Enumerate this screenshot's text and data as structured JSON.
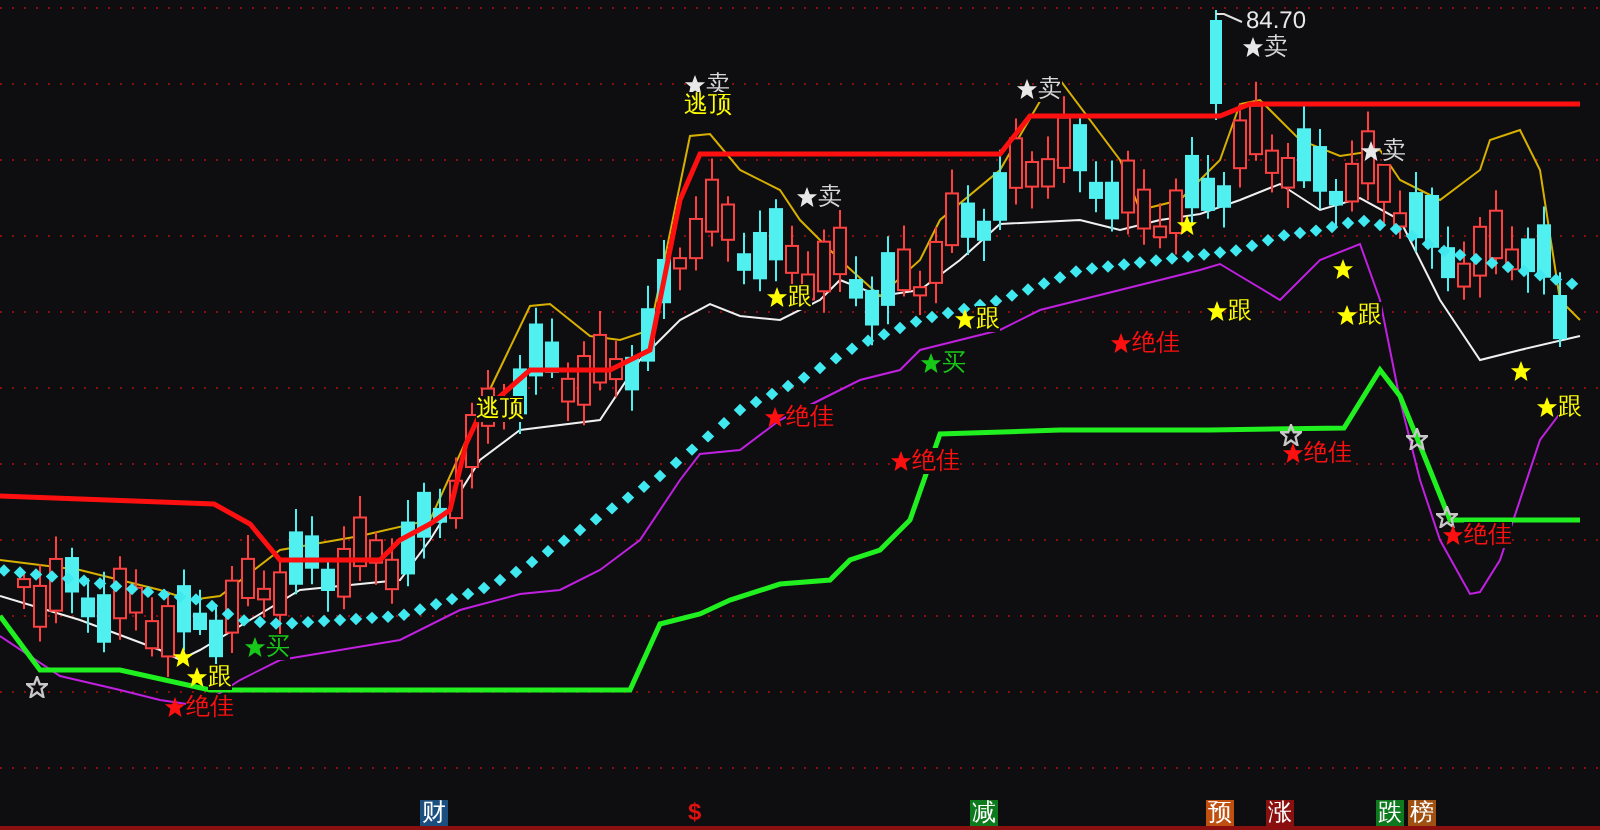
{
  "price_label": "84.70",
  "signals": [
    {
      "kind": "sell",
      "text": "卖"
    },
    {
      "kind": "sell",
      "text": "卖"
    },
    {
      "kind": "escape",
      "text": "逃顶"
    },
    {
      "kind": "sell",
      "text": "卖"
    },
    {
      "kind": "sell",
      "text": "卖"
    },
    {
      "kind": "sell",
      "text": "卖"
    },
    {
      "kind": "follow",
      "text": "跟"
    },
    {
      "kind": "follow",
      "text": "跟"
    },
    {
      "kind": "follow",
      "text": "跟"
    },
    {
      "kind": "follow",
      "text": "跟"
    },
    {
      "kind": "best",
      "text": "绝佳"
    },
    {
      "kind": "buy",
      "text": "买"
    },
    {
      "kind": "escape",
      "text": "逃顶"
    },
    {
      "kind": "follow",
      "text": "跟"
    },
    {
      "kind": "best",
      "text": "绝佳"
    },
    {
      "kind": "best",
      "text": "绝佳"
    },
    {
      "kind": "best",
      "text": "绝佳"
    },
    {
      "kind": "best",
      "text": "绝佳"
    },
    {
      "kind": "buy",
      "text": "买"
    },
    {
      "kind": "follow",
      "text": "跟"
    },
    {
      "kind": "best",
      "text": "绝佳"
    }
  ],
  "bottom_tags": [
    {
      "kind": "tag",
      "text": "财",
      "color": "#1a4f80"
    },
    {
      "kind": "plain",
      "text": "$",
      "color": "#e01010"
    },
    {
      "kind": "tag",
      "text": "减",
      "color": "#0e7a1e"
    },
    {
      "kind": "tag",
      "text": "预",
      "color": "#c05010"
    },
    {
      "kind": "tag",
      "text": "涨",
      "color": "#8a1010"
    },
    {
      "kind": "tag",
      "text": "跌",
      "color": "#0e7a1e"
    },
    {
      "kind": "tag",
      "text": "榜",
      "color": "#a05010"
    }
  ]
}
